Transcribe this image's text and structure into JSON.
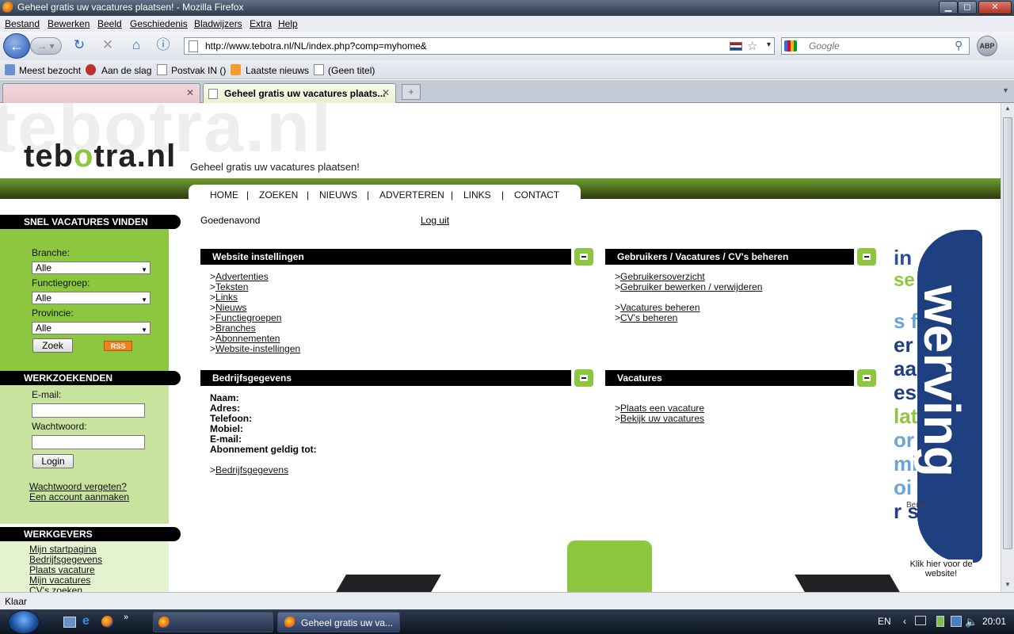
{
  "window": {
    "title": "Geheel gratis uw vacatures plaatsen! - Mozilla Firefox",
    "min": "▁",
    "max": "◻",
    "close": "✕"
  },
  "menu": [
    "Bestand",
    "Bewerken",
    "Beeld",
    "Geschiedenis",
    "Bladwijzers",
    "Extra",
    "Help"
  ],
  "nav": {
    "url": "http://www.tebotra.nl/NL/index.php?comp=myhome&",
    "search_placeholder": "Google",
    "abp": "ABP"
  },
  "bookmarks": [
    "Meest bezocht",
    "Aan de slag",
    "Postvak IN ()",
    "Laatste nieuws",
    "(Geen titel)"
  ],
  "tabs": [
    {
      "label": "",
      "active": false
    },
    {
      "label": "Geheel gratis uw vacatures plaats...",
      "active": true
    }
  ],
  "page": {
    "logo_a": "teb",
    "logo_b": "o",
    "logo_c": "tra.nl",
    "ghost": "tebotra.nl",
    "slogan": "Geheel gratis uw vacatures plaatsen!",
    "topnav": [
      "HOME",
      "ZOEKEN",
      "NIEUWS",
      "ADVERTEREN",
      "LINKS",
      "CONTACT"
    ],
    "greeting": "Goedenavond",
    "logout": "Log uit",
    "sidebar": {
      "snel_title": "SNEL VACATURES VINDEN",
      "branche_label": "Branche:",
      "branche_value": "Alle",
      "functie_label": "Functiegroep:",
      "functie_value": "Alle",
      "provincie_label": "Provincie:",
      "provincie_value": "Alle",
      "zoek": "Zoek",
      "rss": "RSS",
      "werkzoekenden_title": "WERKZOEKENDEN",
      "email_label": "E-mail:",
      "password_label": "Wachtwoord:",
      "login": "Login",
      "forgot": "Wachtwoord vergeten?",
      "create": "Een account aanmaken",
      "werkgevers_title": "WERKGEVERS",
      "werkgevers_links": [
        "Mijn startpagina",
        "Bedrijfsgegevens",
        "Plaats vacature",
        "Mijn vacatures",
        "CV's zoeken"
      ]
    },
    "boxes": {
      "website": {
        "title": "Website instellingen",
        "links": [
          "Advertenties",
          "Teksten",
          "Links",
          "Nieuws",
          "Functiegroepen",
          "Branches",
          "Abonnementen",
          "Website-instellingen"
        ]
      },
      "gebruikers": {
        "title": "Gebruikers / Vacatures / CV's beheren",
        "links": [
          "Gebruikersoverzicht",
          "Gebruiker bewerken / verwijderen",
          "Vacatures beheren",
          "CV's beheren"
        ]
      },
      "bedrijf": {
        "title": "Bedrijfsgegevens",
        "fields": [
          "Naam:",
          "Adres:",
          "Telefoon:",
          "Mobiel:",
          "E-mail:",
          "Abonnement geldig tot:"
        ],
        "link": "Bedrijfsgegevens"
      },
      "vacatures": {
        "title": "Vacatures",
        "links": [
          "Plaats een vacature",
          "Bekijk uw vacatures"
        ]
      }
    },
    "ad": {
      "big": "werving",
      "berge": "Berge",
      "klik": "Klik hier voor de website!"
    }
  },
  "status": "Klaar",
  "taskbar": {
    "task1": "",
    "task2": "Geheel gratis uw va...",
    "lang": "EN",
    "clock": "20:01"
  }
}
